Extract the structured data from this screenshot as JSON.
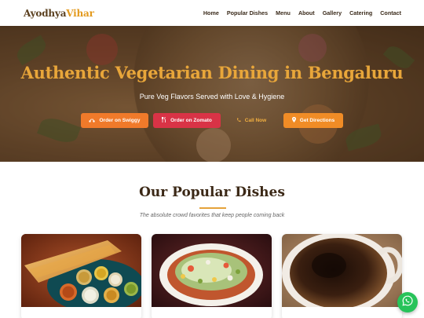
{
  "brand": {
    "part1": "Ayodhya",
    "part2": "Vihar"
  },
  "nav": {
    "items": [
      {
        "label": "Home"
      },
      {
        "label": "Popular Dishes"
      },
      {
        "label": "Menu"
      },
      {
        "label": "About"
      },
      {
        "label": "Gallery"
      },
      {
        "label": "Catering"
      },
      {
        "label": "Contact"
      }
    ]
  },
  "hero": {
    "title": "Authentic Vegetarian Dining in Bengaluru",
    "subtitle": "Pure Veg Flavors Served with Love & Hygiene",
    "buttons": {
      "swiggy": "Order on Swiggy",
      "zomato": "Order on Zomato",
      "call": "Call Now",
      "directions": "Get Directions"
    }
  },
  "popular": {
    "title": "Our Popular Dishes",
    "subtitle": "The absolute crowd favorites that keep people coming back",
    "cards": [
      {
        "image": "masala-dosa-photo"
      },
      {
        "image": "pav-bhaji-photo"
      },
      {
        "image": "filter-coffee-photo"
      }
    ]
  },
  "colors": {
    "accent": "#e39a1d",
    "swiggy": "#f07a2a",
    "zomato": "#d93346",
    "directions": "#f08c26",
    "whatsapp": "#27c35a",
    "heading": "#3b2816"
  },
  "icons": {
    "swiggy": "scooter-icon",
    "zomato": "fork-knife-icon",
    "call": "phone-icon",
    "directions": "map-pin-icon",
    "whatsapp": "whatsapp-icon"
  }
}
